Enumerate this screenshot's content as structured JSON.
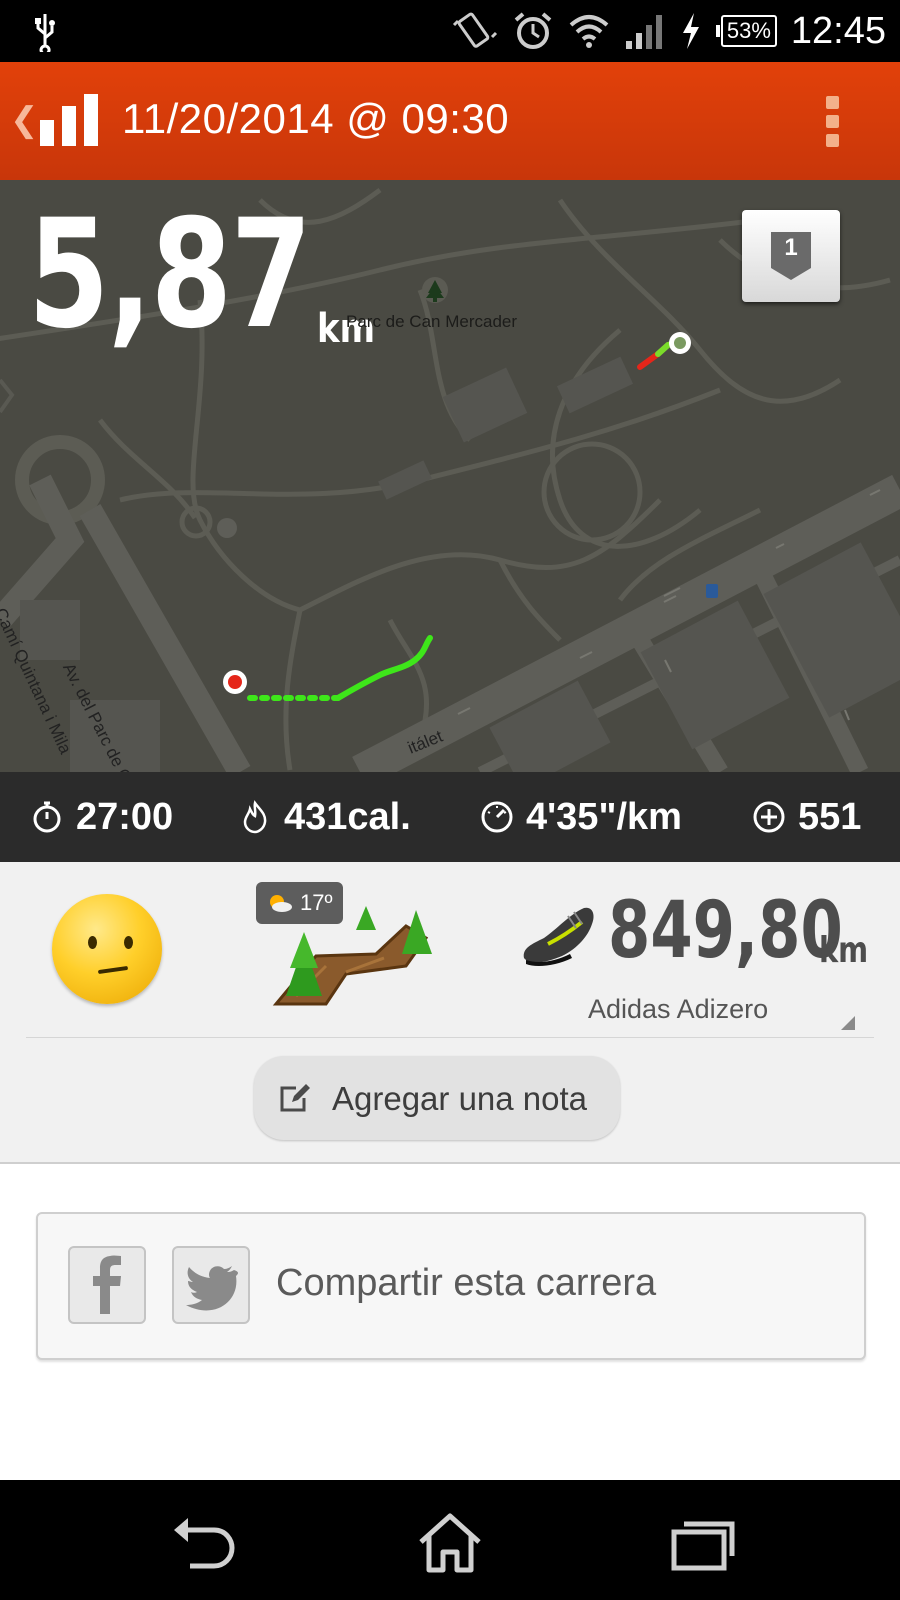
{
  "status_bar": {
    "battery": "53%",
    "time": "12:45",
    "icons": [
      "usb-icon",
      "vibrate-icon",
      "alarm-icon",
      "wifi-icon",
      "signal-icon",
      "charging-icon",
      "battery-icon"
    ]
  },
  "action_bar": {
    "title": "11/20/2014 @ 09:30",
    "icons": [
      "back-chevron-icon",
      "stats-bars-icon",
      "overflow-menu-icon"
    ]
  },
  "map": {
    "distance": "5,87",
    "distance_unit": "km",
    "lap": "1",
    "park_label": "Parc de Can Mercader",
    "street_labels": [
      "Av. del Parc de Can Merca",
      "Camí Quintana i Mila",
      "itálet"
    ],
    "colors": {
      "background": "#4a4a43",
      "route_green": "#3ee61a",
      "route_red": "#e5261a"
    }
  },
  "stats": {
    "duration": "27:00",
    "calories": "431cal.",
    "pace": "4'35\"/km",
    "fuel": "551"
  },
  "details": {
    "mood_icon": "neutral-face-icon",
    "weather": "17º",
    "terrain_icon": "trail-terrain-icon",
    "shoe_distance": "849,80",
    "shoe_unit": "km",
    "shoe_name": "Adidas Adizero",
    "note_button": "Agregar una nota"
  },
  "share": {
    "label": "Compartir esta carrera",
    "icons": [
      "facebook-icon",
      "twitter-icon"
    ]
  },
  "nav_bar": {
    "icons": [
      "nav-back-icon",
      "nav-home-icon",
      "nav-recents-icon"
    ]
  },
  "colors": {
    "accent": "#d83c0a",
    "stats_bar": "#2b2b2b",
    "panel": "#f1f1f1"
  }
}
